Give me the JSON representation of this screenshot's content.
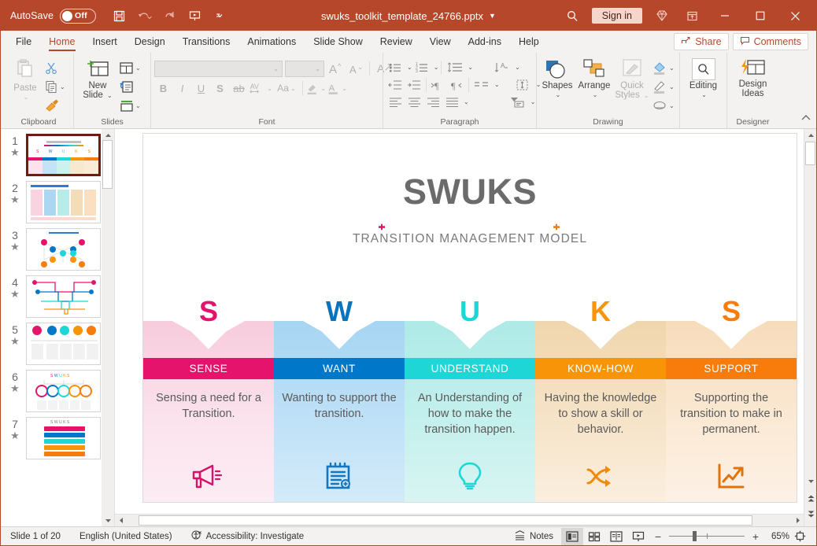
{
  "titlebar": {
    "autosave_label": "AutoSave",
    "autosave_state": "Off",
    "document_title": "swuks_toolkit_template_24766.pptx",
    "signin_label": "Sign in",
    "qat": [
      {
        "name": "save-icon",
        "label": "Save"
      },
      {
        "name": "undo-icon",
        "label": "Undo"
      },
      {
        "name": "redo-icon",
        "label": "Redo"
      },
      {
        "name": "start-presentation-icon",
        "label": "Start From Beginning"
      },
      {
        "name": "customize-qat-icon",
        "label": "Customize Quick Access Toolbar"
      }
    ],
    "window_buttons": [
      "minimize",
      "maximize",
      "close"
    ]
  },
  "ribbon": {
    "tabs": [
      {
        "label": "File",
        "active": false
      },
      {
        "label": "Home",
        "active": true
      },
      {
        "label": "Insert",
        "active": false
      },
      {
        "label": "Design",
        "active": false
      },
      {
        "label": "Transitions",
        "active": false
      },
      {
        "label": "Animations",
        "active": false
      },
      {
        "label": "Slide Show",
        "active": false
      },
      {
        "label": "Review",
        "active": false
      },
      {
        "label": "View",
        "active": false
      },
      {
        "label": "Add-ins",
        "active": false
      },
      {
        "label": "Help",
        "active": false
      }
    ],
    "share_label": "Share",
    "comments_label": "Comments",
    "groups": {
      "clipboard": {
        "label": "Clipboard",
        "paste_label": "Paste",
        "items": [
          "Cut",
          "Copy",
          "Format Painter"
        ]
      },
      "slides": {
        "label": "Slides",
        "new_slide_label": "New\nSlide",
        "items": [
          "Layout",
          "Reset",
          "Section"
        ]
      },
      "font": {
        "label": "Font",
        "font_name_value": "",
        "font_size_value": "",
        "buttons": [
          "B",
          "I",
          "U",
          "S",
          "ab",
          "AV",
          "Aa"
        ]
      },
      "paragraph": {
        "label": "Paragraph"
      },
      "drawing": {
        "label": "Drawing",
        "shapes_label": "Shapes",
        "arrange_label": "Arrange",
        "quick_styles_label": "Quick\nStyles"
      },
      "editing": {
        "label": "",
        "editing_label": "Editing"
      },
      "designer": {
        "label": "Designer",
        "design_ideas_label": "Design\nIdeas"
      }
    }
  },
  "thumbnails": [
    {
      "number": "1",
      "selected": true
    },
    {
      "number": "2",
      "selected": false
    },
    {
      "number": "3",
      "selected": false
    },
    {
      "number": "4",
      "selected": false
    },
    {
      "number": "5",
      "selected": false
    },
    {
      "number": "6",
      "selected": false
    },
    {
      "number": "7",
      "selected": false
    }
  ],
  "slide": {
    "title": "SWUKS",
    "subtitle": "TRANSITION MANAGEMENT MODEL",
    "columns": [
      {
        "letter": "S",
        "heading": "SENSE",
        "body": "Sensing a need for a Transition.",
        "icon": "megaphone-icon",
        "accent": "#e6136c",
        "panel": "#f9d3e0",
        "panel_light": "#fbe2ec"
      },
      {
        "letter": "W",
        "heading": "WANT",
        "body": "Wanting to support the transition.",
        "icon": "notepad-icon",
        "accent": "#0077c8",
        "panel": "#abd7f2",
        "panel_light": "#c3e3f7"
      },
      {
        "letter": "U",
        "heading": "UNDERSTAND",
        "body": "An Understanding of how to make the transition happen.",
        "icon": "lightbulb-icon",
        "accent": "#1fd6d6",
        "panel": "#b7ece9",
        "panel_light": "#cbf2ef"
      },
      {
        "letter": "K",
        "heading": "KNOW-HOW",
        "body": "Having the knowledge to show a skill or behavior.",
        "icon": "shuffle-arrows-icon",
        "accent": "#f89407",
        "panel": "#f4dcb9",
        "panel_light": "#f8e8cf"
      },
      {
        "letter": "S",
        "heading": "SUPPORT",
        "body": "Supporting the transition to make in permanent.",
        "icon": "growth-chart-icon",
        "accent": "#f77c0b",
        "panel": "#fadfc0",
        "panel_light": "#fcead6"
      }
    ]
  },
  "status": {
    "slide_counter": "Slide 1 of 20",
    "language": "English (United States)",
    "accessibility": "Accessibility: Investigate",
    "notes_label": "Notes",
    "zoom_level": "65%",
    "views": [
      "normal-view",
      "slide-sorter-view",
      "reading-view",
      "slide-show-view"
    ]
  }
}
